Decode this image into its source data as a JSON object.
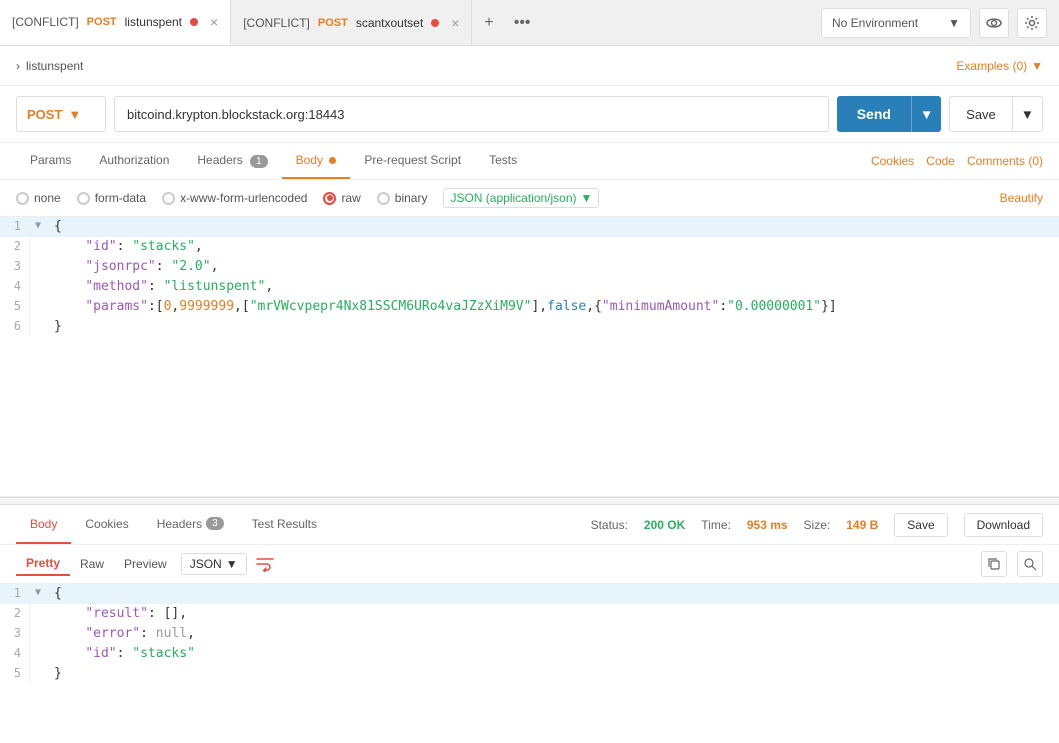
{
  "tabs": [
    {
      "id": "tab1",
      "conflict": "[CONFLICT]",
      "method": "POST",
      "name": "listunspent",
      "active": true
    },
    {
      "id": "tab2",
      "conflict": "[CONFLICT]",
      "method": "POST",
      "name": "scantxoutset",
      "active": false
    }
  ],
  "tab_add_label": "+",
  "tab_more_label": "•••",
  "env_selector": {
    "label": "No Environment",
    "chevron": "▼"
  },
  "breadcrumb": {
    "arrow": "›",
    "item": "listunspent"
  },
  "examples_label": "Examples (0)",
  "examples_arrow": "▼",
  "method": "POST",
  "url": "bitcoind.krypton.blockstack.org:18443",
  "send_label": "Send",
  "send_chevron": "▼",
  "save_label": "Save",
  "save_chevron": "▼",
  "req_tabs": [
    {
      "id": "params",
      "label": "Params",
      "badge": null
    },
    {
      "id": "auth",
      "label": "Authorization",
      "badge": null
    },
    {
      "id": "headers",
      "label": "Headers",
      "badge": "1"
    },
    {
      "id": "body",
      "label": "Body",
      "badge": null,
      "dot": true,
      "active": true
    },
    {
      "id": "prerequest",
      "label": "Pre-request Script",
      "badge": null
    },
    {
      "id": "tests",
      "label": "Tests",
      "badge": null
    }
  ],
  "req_right": {
    "cookies": "Cookies",
    "code": "Code",
    "comments": "Comments (0)"
  },
  "body_options": [
    {
      "id": "none",
      "label": "none"
    },
    {
      "id": "form-data",
      "label": "form-data"
    },
    {
      "id": "urlencoded",
      "label": "x-www-form-urlencoded"
    },
    {
      "id": "raw",
      "label": "raw",
      "selected": true
    },
    {
      "id": "binary",
      "label": "binary"
    }
  ],
  "json_format_label": "JSON (application/json)",
  "beautify_label": "Beautify",
  "req_body_lines": [
    {
      "num": 1,
      "arrow": "▼",
      "content": "{",
      "type": "brace"
    },
    {
      "num": 2,
      "arrow": "",
      "content_key": "\"id\"",
      "content_val": "\"stacks\"",
      "trailing": ","
    },
    {
      "num": 3,
      "arrow": "",
      "content_key": "\"jsonrpc\"",
      "content_val": "\"2.0\"",
      "trailing": ","
    },
    {
      "num": 4,
      "arrow": "",
      "content_key": "\"method\"",
      "content_val": "\"listunspent\"",
      "trailing": ","
    },
    {
      "num": 5,
      "arrow": "",
      "content_raw": "\"params\":[0,9999999,[\"mrVWcvpepr4Nx81SSCM6URo4vaJZzXiM9V\"],false,{\"minimumAmount\":\"0.00000001\"}]"
    },
    {
      "num": 6,
      "arrow": "",
      "content": "}",
      "type": "brace"
    }
  ],
  "response": {
    "tabs": [
      {
        "id": "body",
        "label": "Body",
        "active": true
      },
      {
        "id": "cookies",
        "label": "Cookies"
      },
      {
        "id": "headers",
        "label": "Headers",
        "badge": "3"
      },
      {
        "id": "test_results",
        "label": "Test Results"
      }
    ],
    "status_label": "Status:",
    "status_value": "200 OK",
    "time_label": "Time:",
    "time_value": "953 ms",
    "size_label": "Size:",
    "size_value": "149 B",
    "save_btn": "Save",
    "download_btn": "Download",
    "format_tabs": [
      {
        "id": "pretty",
        "label": "Pretty",
        "active": true
      },
      {
        "id": "raw",
        "label": "Raw"
      },
      {
        "id": "preview",
        "label": "Preview"
      }
    ],
    "format_select": "JSON",
    "lines": [
      {
        "num": 1,
        "arrow": "▼",
        "content_brace": "{",
        "highlighted": true
      },
      {
        "num": 2,
        "arrow": "",
        "content_key": "\"result\"",
        "content_val": "[]",
        "trailing": ",",
        "highlighted": false
      },
      {
        "num": 3,
        "arrow": "",
        "content_key": "\"error\"",
        "content_val": "null",
        "trailing": ",",
        "highlighted": false
      },
      {
        "num": 4,
        "arrow": "",
        "content_key": "\"id\"",
        "content_val": "\"stacks\"",
        "trailing": "",
        "highlighted": false
      },
      {
        "num": 5,
        "arrow": "",
        "content_brace": "}",
        "highlighted": false
      }
    ]
  }
}
